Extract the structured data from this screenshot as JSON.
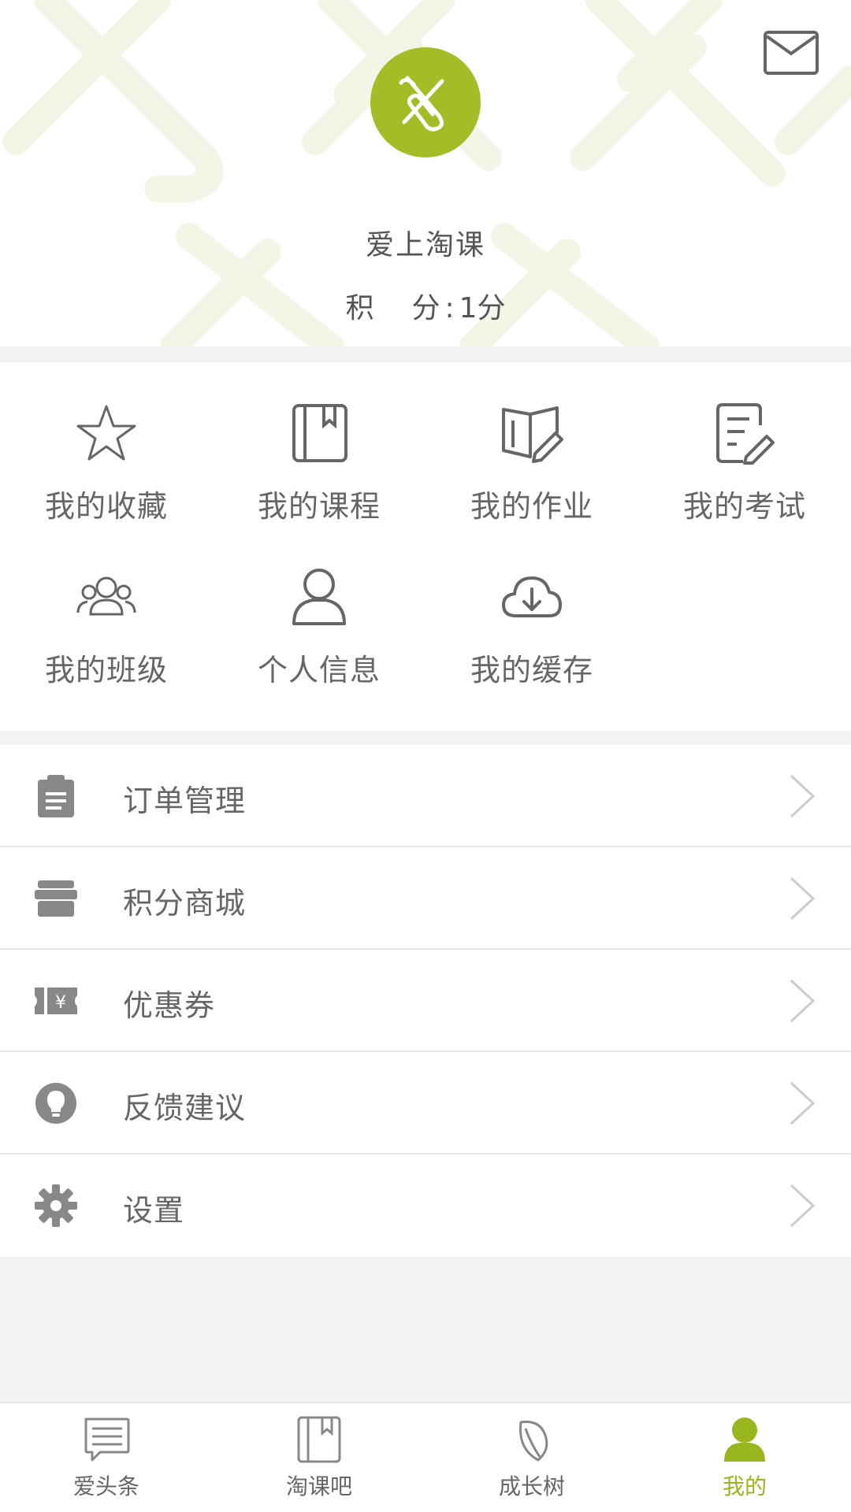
{
  "header": {
    "username": "爱上淘课",
    "points_label": "积　分:",
    "points_value": "1分",
    "mail_icon": "mail-icon",
    "avatar_icon": "paperclip-x-logo",
    "accent_color": "#a2bd25"
  },
  "grid": {
    "items": [
      {
        "label": "我的收藏",
        "icon": "star-icon"
      },
      {
        "label": "我的课程",
        "icon": "book-icon"
      },
      {
        "label": "我的作业",
        "icon": "open-book-pen-icon"
      },
      {
        "label": "我的考试",
        "icon": "paper-pen-icon"
      },
      {
        "label": "我的班级",
        "icon": "group-icon"
      },
      {
        "label": "个人信息",
        "icon": "person-icon"
      },
      {
        "label": "我的缓存",
        "icon": "cloud-download-icon"
      }
    ]
  },
  "list": {
    "items": [
      {
        "label": "订单管理",
        "icon": "clipboard-icon"
      },
      {
        "label": "积分商城",
        "icon": "store-icon"
      },
      {
        "label": "优惠券",
        "icon": "coupon-icon"
      },
      {
        "label": "反馈建议",
        "icon": "lightbulb-icon"
      },
      {
        "label": "设置",
        "icon": "gear-icon"
      }
    ]
  },
  "tabbar": {
    "active_index": 3,
    "active_color": "#9ab61f",
    "tabs": [
      {
        "label": "爱头条",
        "icon": "chat-news-icon"
      },
      {
        "label": "淘课吧",
        "icon": "book-icon"
      },
      {
        "label": "成长树",
        "icon": "leaf-icon"
      },
      {
        "label": "我的",
        "icon": "user-icon"
      }
    ]
  }
}
